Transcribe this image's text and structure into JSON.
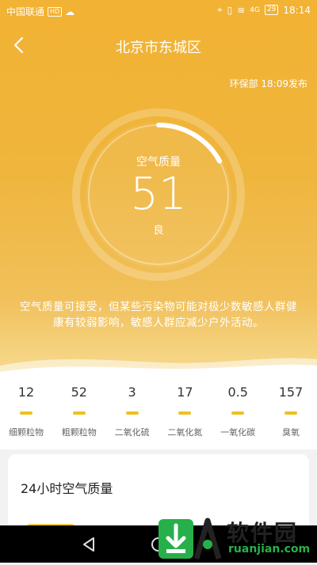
{
  "status_bar": {
    "carrier": "中国联通",
    "net_badge": "HD",
    "time": "18:14",
    "signal": "4G",
    "battery": "29"
  },
  "header": {
    "title": "北京市东城区",
    "publish_info": "环保部 18:09发布"
  },
  "aqi": {
    "label": "空气质量",
    "value": "51",
    "level": "良",
    "progress_fraction": 0.17,
    "description": "空气质量可接受，但某些污染物可能对极少数敏感人群健康有较弱影响，敏感人群应减少户外活动。"
  },
  "pollutants": [
    {
      "value": "12",
      "name": "细颗粒物"
    },
    {
      "value": "52",
      "name": "粗颗粒物"
    },
    {
      "value": "3",
      "name": "二氧化硫"
    },
    {
      "value": "17",
      "name": "二氧化氮"
    },
    {
      "value": "0.5",
      "name": "一氧化碳"
    },
    {
      "value": "157",
      "name": "臭氧"
    }
  ],
  "hourly_card": {
    "title": "24小时空气质量"
  },
  "watermark": {
    "brand": "软件园",
    "url": "ruanjian.com"
  },
  "colors": {
    "accent": "#f2b233",
    "bar": "#f0c020"
  }
}
